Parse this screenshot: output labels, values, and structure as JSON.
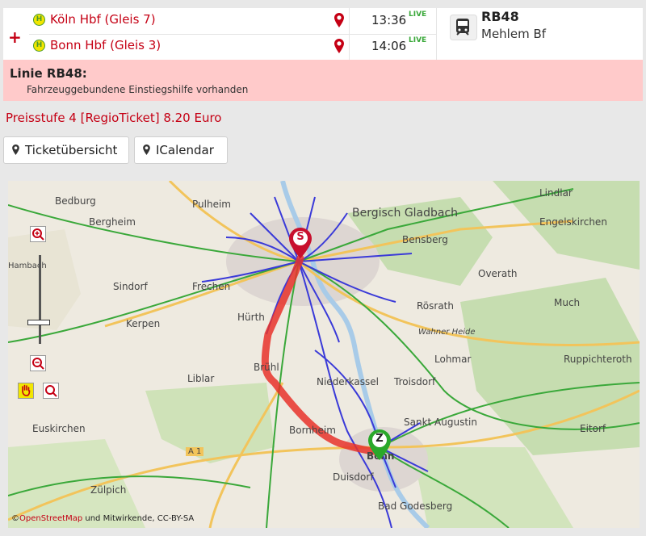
{
  "connection": {
    "stops": [
      {
        "name": "Köln Hbf (Gleis 7)",
        "time": "13:36",
        "live": "LIVE"
      },
      {
        "name": "Bonn Hbf (Gleis 3)",
        "time": "14:06",
        "live": "LIVE"
      }
    ],
    "expand_symbol": "+",
    "train": {
      "line": "RB48",
      "destination": "Mehlem Bf"
    }
  },
  "notice": {
    "title": "Linie RB48:",
    "text": "Fahrzeuggebundene Einstiegshilfe vorhanden"
  },
  "price_text": "Preisstufe 4 [RegioTicket] 8.20 Euro",
  "buttons": {
    "ticket": "Ticketübersicht",
    "calendar": "ICalendar"
  },
  "map": {
    "labels": [
      "Bedburg",
      "Pulheim",
      "Bergisch Gladbach",
      "Lindlar",
      "Engelskirchen",
      "Bergheim",
      "Bensberg",
      "Sindorf",
      "Frechen",
      "Overath",
      "Kerpen",
      "Hürth",
      "Rösrath",
      "Much",
      "Wahner Heide",
      "Lohmar",
      "Ruppichteroth",
      "Brühl",
      "Liblar",
      "Niederkassel",
      "Troisdorf",
      "Bornheim",
      "Sankt Augustin",
      "Eitorf",
      "Bonn",
      "Euskirchen",
      "Zülpich",
      "Duisdorf",
      "Bad Godesberg",
      "Hambach"
    ],
    "start_marker": "S",
    "end_marker": "Z",
    "attribution_prefix": "©",
    "attribution_link": "OpenStreetMap",
    "attribution_suffix": " und Mitwirkende, CC-BY-SA",
    "road_label": "A 1",
    "colors": {
      "route": "#e8322a",
      "rail": "#3a3ad8",
      "forest": "#bcd9a0",
      "start": "#c8102e",
      "end": "#2aa82a"
    }
  }
}
